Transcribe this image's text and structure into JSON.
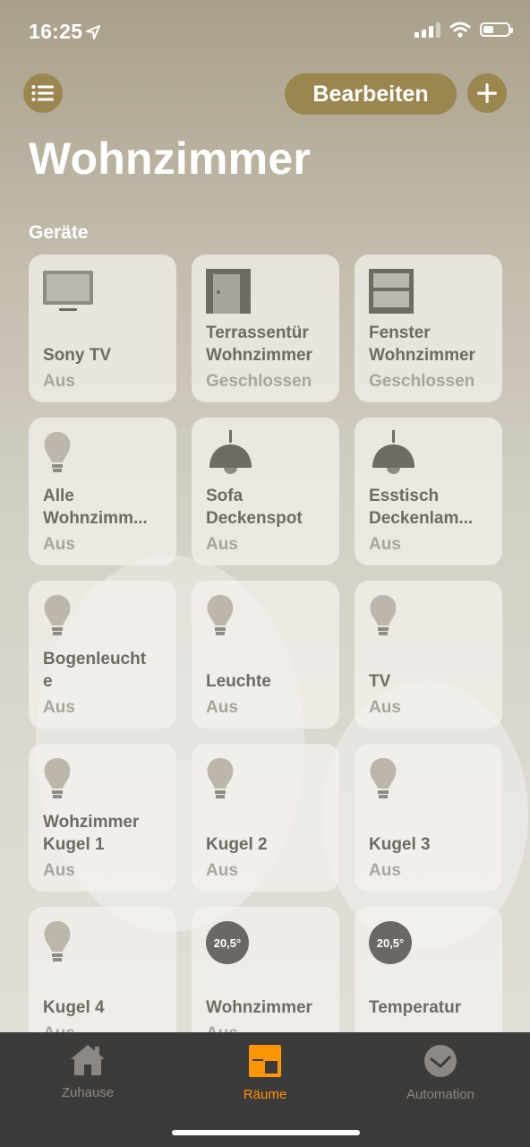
{
  "status": {
    "time": "16:25"
  },
  "header": {
    "edit_label": "Bearbeiten",
    "room_title": "Wohnzimmer",
    "section_label": "Geräte"
  },
  "accessories": [
    {
      "name": "Sony TV",
      "state": "Aus",
      "icon": "tv-icon"
    },
    {
      "name": "Terrassentür\nWohnzimmer",
      "state": "Geschlossen",
      "icon": "door-icon"
    },
    {
      "name": "Fenster\nWohnzimmer",
      "state": "Geschlossen",
      "icon": "window-icon"
    },
    {
      "name": "Alle\nWohnzimm...",
      "state": "Aus",
      "icon": "bulb-icon"
    },
    {
      "name": "Sofa\nDeckenspot",
      "state": "Aus",
      "icon": "pendant-lamp-icon"
    },
    {
      "name": "Esstisch\nDeckenlam...",
      "state": "Aus",
      "icon": "pendant-lamp-icon"
    },
    {
      "name": "Bogenleucht\ne",
      "state": "Aus",
      "icon": "bulb-icon"
    },
    {
      "name": "Leuchte",
      "state": "Aus",
      "icon": "bulb-icon"
    },
    {
      "name": "TV",
      "state": "Aus",
      "icon": "bulb-icon"
    },
    {
      "name": "Wohzimmer\nKugel 1",
      "state": "Aus",
      "icon": "bulb-icon"
    },
    {
      "name": "Kugel 2",
      "state": "Aus",
      "icon": "bulb-icon"
    },
    {
      "name": "Kugel 3",
      "state": "Aus",
      "icon": "bulb-icon"
    },
    {
      "name": "Kugel 4",
      "state": "Aus",
      "icon": "bulb-icon"
    },
    {
      "name": "Wohnzimmer",
      "state": "Aus",
      "icon": "temperature-icon",
      "temp": "20,5°"
    },
    {
      "name": "Temperatur",
      "state": "",
      "icon": "temperature-icon",
      "temp": "20,5°"
    }
  ],
  "tabs": [
    {
      "label": "Zuhause",
      "icon": "home-icon",
      "active": false
    },
    {
      "label": "Räume",
      "icon": "rooms-icon",
      "active": true
    },
    {
      "label": "Automation",
      "icon": "clock-icon",
      "active": false
    }
  ],
  "colors": {
    "accent": "#9b8650",
    "active_tab": "#ff9500",
    "tabbar": "#3d3b39"
  }
}
